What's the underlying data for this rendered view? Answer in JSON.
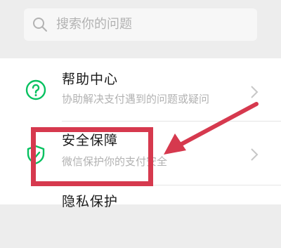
{
  "search": {
    "placeholder": "搜索你的问题",
    "icon": "search-icon"
  },
  "menu_items": [
    {
      "title": "帮助中心",
      "subtitle": "协助解决支付遇到的问题或疑问",
      "icon": "question-circle-icon"
    },
    {
      "title": "安全保障",
      "subtitle": "微信保护你的支付安全",
      "icon": "shield-icon"
    },
    {
      "title": "隐私保护",
      "icon": "privacy-icon"
    }
  ],
  "colors": {
    "accent": "#07c160",
    "highlight": "#d6394e",
    "background": "#ededed"
  }
}
